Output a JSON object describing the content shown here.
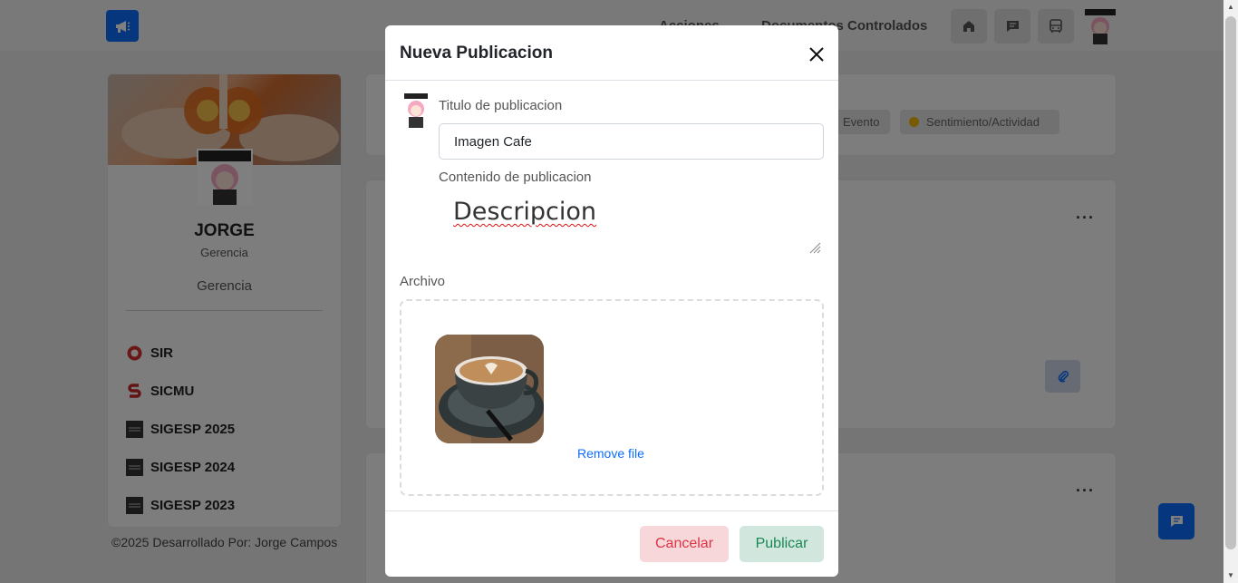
{
  "navbar": {
    "logo_icon": "megaphone-icon",
    "links": {
      "acciones": "Acciones",
      "documentos": "Documentos Controlados"
    },
    "icons": [
      "home-icon",
      "chat-icon",
      "bus-icon"
    ]
  },
  "profile": {
    "name": "JORGE",
    "role": "Gerencia",
    "department": "Gerencia",
    "systems": [
      {
        "label": "SIR",
        "icon": "sir-icon"
      },
      {
        "label": "SICMU",
        "icon": "sicmu-icon"
      },
      {
        "label": "SIGESP 2025",
        "icon": "sigesp-icon"
      },
      {
        "label": "SIGESP 2024",
        "icon": "sigesp-icon"
      },
      {
        "label": "SIGESP 2023",
        "icon": "sigesp-icon"
      }
    ]
  },
  "footer": {
    "text": "©2025 Desarrollado Por: Jorge Campos"
  },
  "feed": {
    "chips": {
      "evento": "Evento",
      "sentimiento": "Sentimiento/Actividad"
    }
  },
  "modal": {
    "title": "Nueva Publicacion",
    "title_label": "Titulo de publicacion",
    "title_value": "Imagen Cafe",
    "content_label": "Contenido de publicacion",
    "content_value": "Descripcion",
    "file_label": "Archivo",
    "remove_file": "Remove file",
    "cancel": "Cancelar",
    "publish": "Publicar"
  },
  "colors": {
    "primary": "#0d6efd",
    "cancel_bg": "#f8d7da",
    "cancel_text": "#dc3545",
    "publish_bg": "#d1e7dd",
    "publish_text": "#198754"
  }
}
